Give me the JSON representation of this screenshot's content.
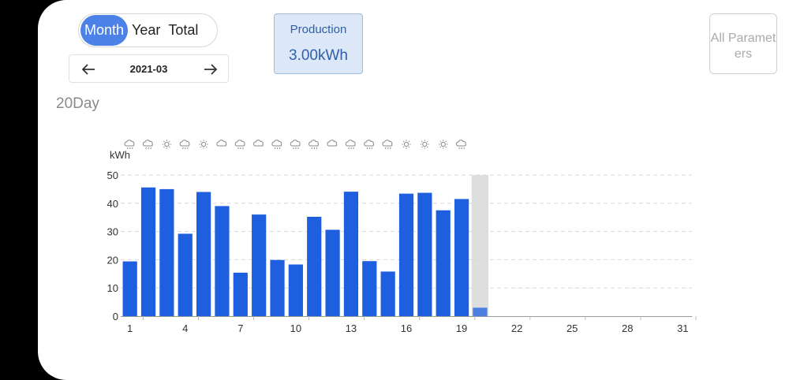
{
  "tabs": [
    {
      "label": "Month",
      "active": true
    },
    {
      "label": "Year",
      "active": false
    },
    {
      "label": "Total",
      "active": false
    }
  ],
  "date_nav": {
    "value": "2021-03",
    "prev_icon": "arrow-left-icon",
    "next_icon": "arrow-right-icon"
  },
  "production": {
    "label": "Production",
    "value": "3.00kWh"
  },
  "all_params_label": "All Parameters",
  "day_label": "20Day",
  "colors": {
    "accent": "#4c82e8",
    "bar": "#1e5fe0",
    "selected_bar": "#4b7fe0",
    "highlight": "#dedede",
    "gridline": "#d8d8d8"
  },
  "chart_data": {
    "type": "bar",
    "ylabel": "kWh",
    "ylim": [
      0,
      50
    ],
    "yticks": [
      0,
      10,
      20,
      30,
      40,
      50
    ],
    "xticks": [
      1,
      4,
      7,
      10,
      13,
      16,
      19,
      22,
      25,
      28,
      31
    ],
    "x": [
      1,
      2,
      3,
      4,
      5,
      6,
      7,
      8,
      9,
      10,
      11,
      12,
      13,
      14,
      15,
      16,
      17,
      18,
      19,
      20
    ],
    "values": [
      19.4,
      45.6,
      45.0,
      29.2,
      44.0,
      39.0,
      15.4,
      36.0,
      19.9,
      18.3,
      35.2,
      30.6,
      44.1,
      19.5,
      15.8,
      43.4,
      43.7,
      37.5,
      41.5,
      3.0
    ],
    "total_days": 31,
    "selected_day": 20,
    "grid": "horizontal dashed",
    "weather": [
      "rain",
      "rain",
      "sun",
      "rain",
      "sun",
      "cloud",
      "rain",
      "cloud",
      "rain",
      "rain",
      "rain",
      "cloud",
      "rain",
      "rain",
      "rain",
      "sun",
      "sun",
      "sun",
      "rain"
    ]
  }
}
